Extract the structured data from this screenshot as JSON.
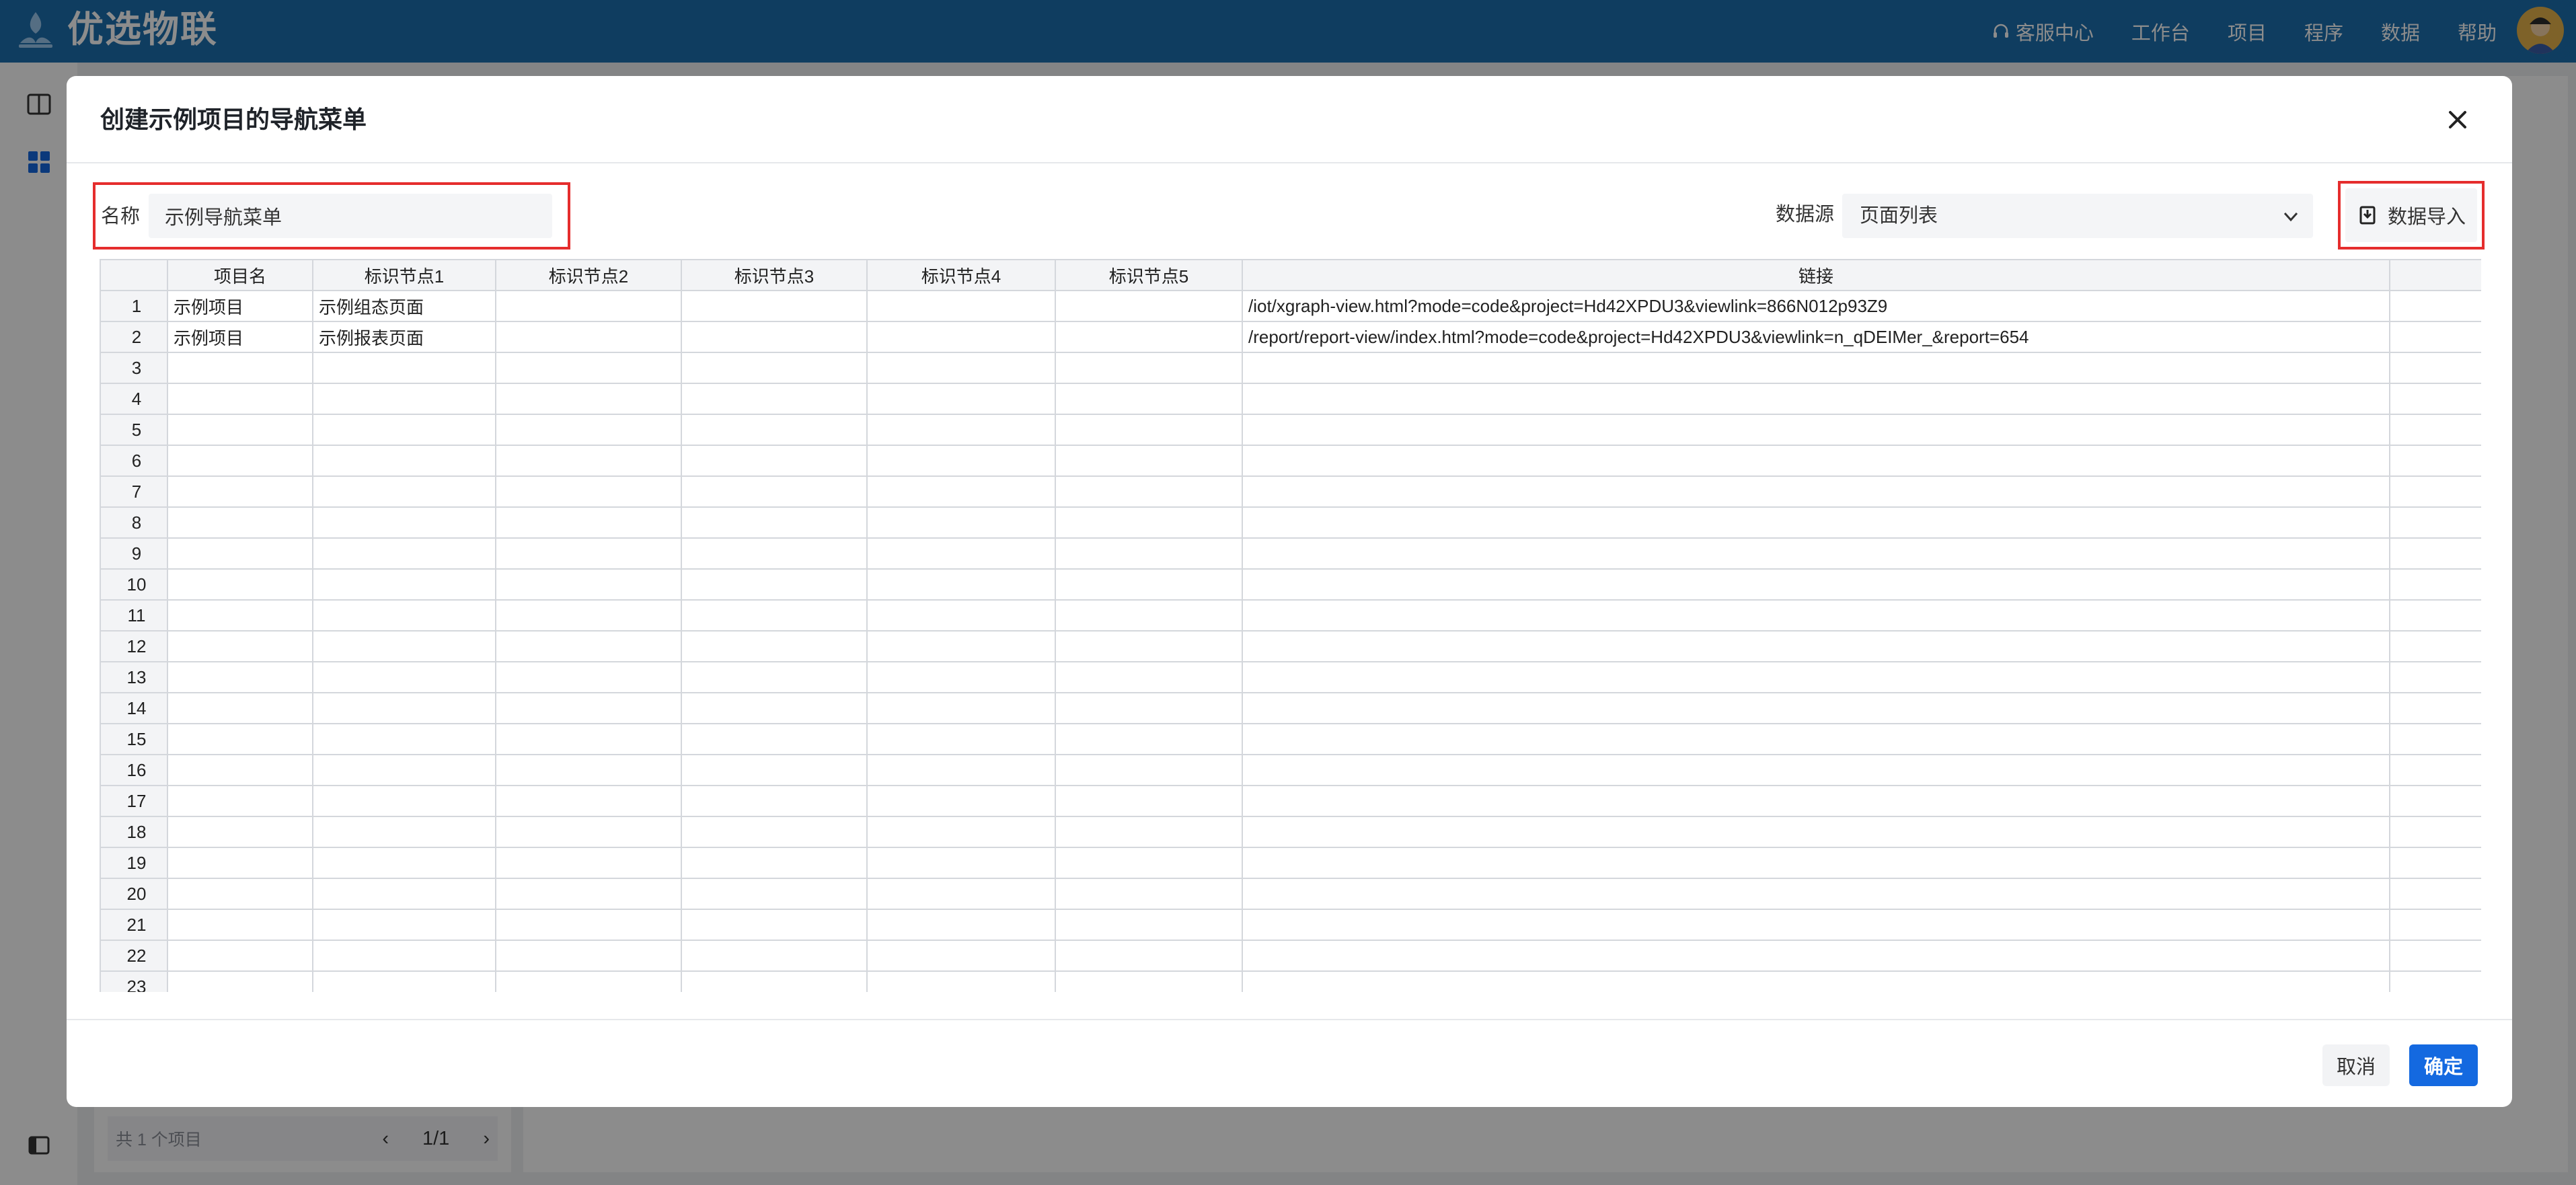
{
  "app": {
    "logo_text": "优选物联",
    "nav": [
      {
        "label": "客服中心",
        "icon": "headset-icon"
      },
      {
        "label": "工作台"
      },
      {
        "label": "项目"
      },
      {
        "label": "程序"
      },
      {
        "label": "数据"
      },
      {
        "label": "帮助"
      }
    ]
  },
  "background": {
    "footer_count": "共 1 个项目",
    "pager": "1/1"
  },
  "dialog": {
    "title": "创建示例项目的导航菜单",
    "name_label": "名称",
    "name_value": "示例导航菜单",
    "datasource_label": "数据源",
    "datasource_value": "页面列表",
    "import_label": "数据导入",
    "cancel_label": "取消",
    "ok_label": "确定"
  },
  "table": {
    "columns": [
      "项目名",
      "标识节点1",
      "标识节点2",
      "标识节点3",
      "标识节点4",
      "标识节点5",
      "链接",
      ""
    ],
    "rows": [
      [
        "示例项目",
        "示例组态页面",
        "",
        "",
        "",
        "",
        "/iot/xgraph-view.html?mode=code&project=Hd42XPDU3&viewlink=866N012p93Z9",
        ""
      ],
      [
        "示例项目",
        "示例报表页面",
        "",
        "",
        "",
        "",
        "/report/report-view/index.html?mode=code&project=Hd42XPDU3&viewlink=n_qDEIMer_&report=654",
        ""
      ]
    ],
    "row_count": 23
  },
  "colors": {
    "topbar": "#1d6faf",
    "primary": "#1469e0",
    "highlight_border": "#e52d2d"
  }
}
